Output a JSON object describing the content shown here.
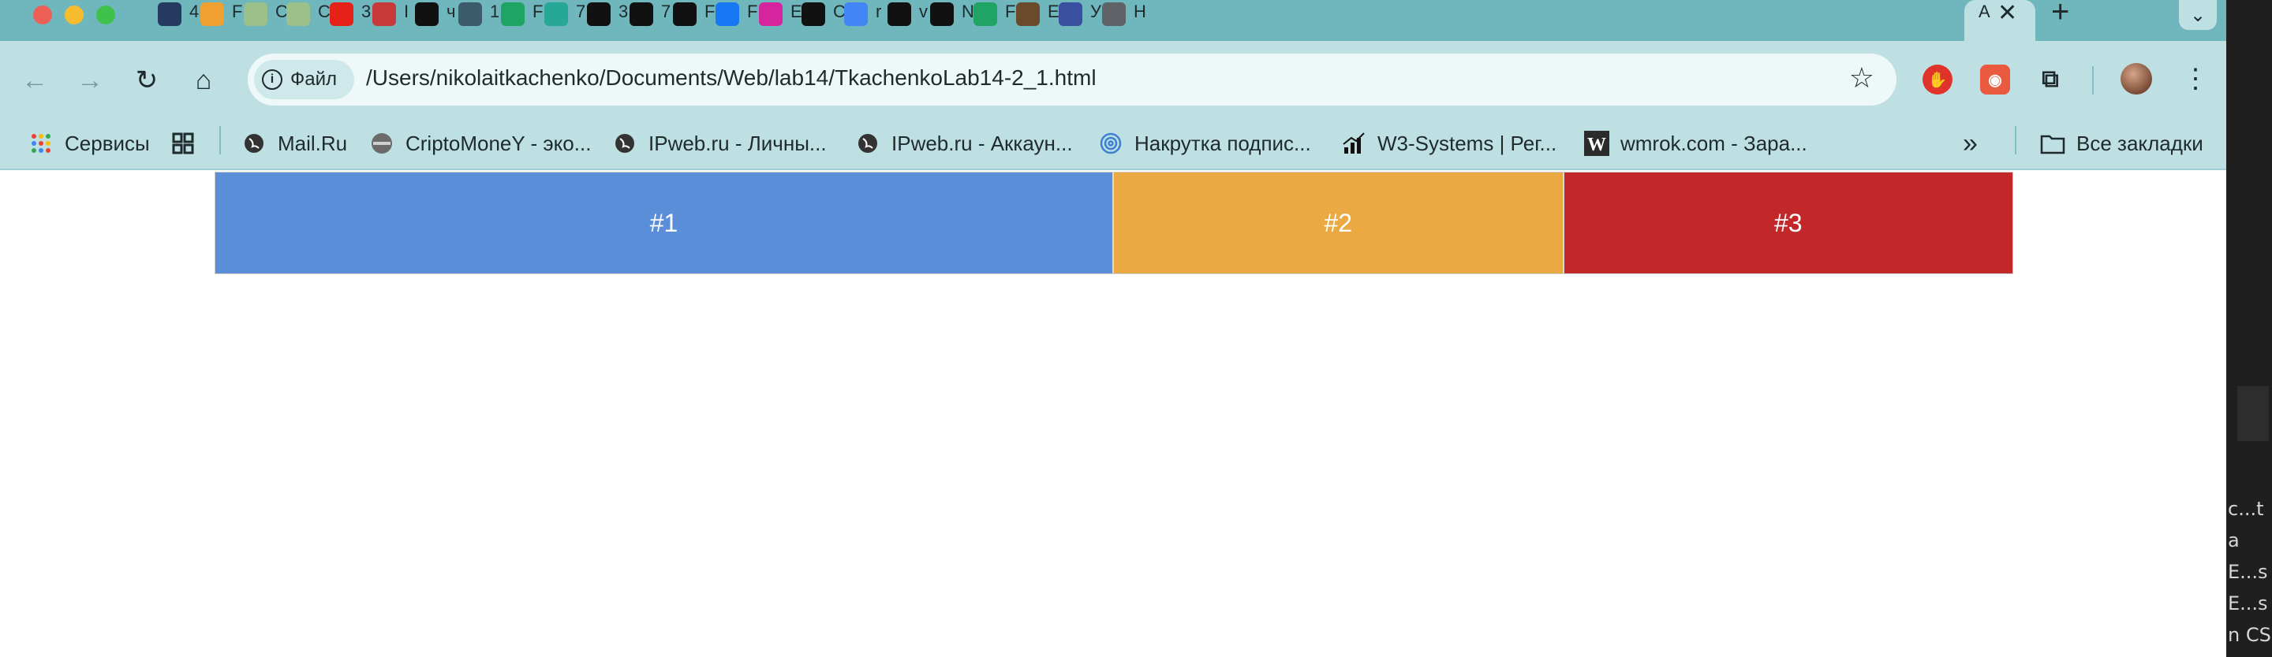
{
  "tabs": [
    {
      "icon": "m-icon",
      "letter": "4",
      "color": "#243a5e"
    },
    {
      "icon": "smile-coin-icon",
      "letter": "F",
      "color": "#f0a030"
    },
    {
      "icon": "landscape-icon",
      "letter": "C",
      "color": "#9cc08a"
    },
    {
      "icon": "landscape-icon",
      "letter": "C",
      "color": "#9cc08a"
    },
    {
      "icon": "youtube-icon",
      "letter": "3",
      "color": "#e62117"
    },
    {
      "icon": "shield-icon",
      "letter": "I",
      "color": "#c83a3a"
    },
    {
      "icon": "yin-yang-icon",
      "letter": "ч",
      "color": "#111111"
    },
    {
      "icon": "chevron-down-icon",
      "letter": "1",
      "color": "#3c5a6a"
    },
    {
      "icon": "google-drive-icon",
      "letter": "F",
      "color": "#1fa463"
    },
    {
      "icon": "m-mark-icon",
      "letter": "7",
      "color": "#27a795"
    },
    {
      "icon": "fd-icon",
      "letter": "3",
      "color": "#111111"
    },
    {
      "icon": "fd-icon",
      "letter": "7",
      "color": "#111111"
    },
    {
      "icon": "fd-icon",
      "letter": "F",
      "color": "#111111"
    },
    {
      "icon": "facebook-icon",
      "letter": "F",
      "color": "#1877f2"
    },
    {
      "icon": "instagram-icon",
      "letter": "E",
      "color": "#d6249f"
    },
    {
      "icon": "openai-icon",
      "letter": "C",
      "color": "#111111"
    },
    {
      "icon": "google-icon",
      "letter": "r",
      "color": "#4285f4"
    },
    {
      "icon": "github-icon",
      "letter": "v",
      "color": "#111111"
    },
    {
      "icon": "github-icon",
      "letter": "N",
      "color": "#111111"
    },
    {
      "icon": "google-drive-icon",
      "letter": "F",
      "color": "#1fa463"
    },
    {
      "icon": "graduation-icon",
      "letter": "E",
      "color": "#6a4a2a"
    },
    {
      "icon": "emblem-icon",
      "letter": "У",
      "color": "#3a4fa0"
    },
    {
      "icon": "chrome-icon",
      "letter": "H",
      "color": "#5f6368"
    }
  ],
  "active_tab": {
    "letter": "A",
    "close": "✕"
  },
  "new_tab": "+",
  "tab_search": "⌄",
  "nav": {
    "back": "←",
    "forward": "→",
    "reload": "↻",
    "home": "⌂"
  },
  "omnibox": {
    "chip_label": "Файл",
    "url": "/Users/nikolaitkachenko/Documents/Web/lab14/TkachenkoLab14-2_1.html"
  },
  "bookmarks": [
    {
      "icon": "apps-grid-icon",
      "label": "Сервисы"
    },
    {
      "icon": "tab-groups-icon",
      "label": ""
    },
    {
      "icon": "globe-icon",
      "label": "Mail.Ru"
    },
    {
      "icon": "coin-icon",
      "label": "CriptoMoneY - эко..."
    },
    {
      "icon": "globe-icon",
      "label": "IPweb.ru - Личны..."
    },
    {
      "icon": "globe-icon",
      "label": "IPweb.ru - Аккаун..."
    },
    {
      "icon": "spiral-icon",
      "label": "Накрутка подпис..."
    },
    {
      "icon": "chart-icon",
      "label": "W3-Systems | Рег..."
    },
    {
      "icon": "w-logo-icon",
      "label": "wmrok.com - Зара..."
    }
  ],
  "bookmarks_more": "»",
  "all_bookmarks": "Все закладки",
  "side_panel_lines": [
    "c...t",
    "a",
    "E...s",
    "E...s",
    "n CSS"
  ],
  "page": {
    "blocks": [
      {
        "label": "#1",
        "color": "#5b8ed8",
        "flex": 2
      },
      {
        "label": "#2",
        "color": "#eba943",
        "flex": 1
      },
      {
        "label": "#3",
        "color": "#c22729",
        "flex": 1
      }
    ]
  }
}
